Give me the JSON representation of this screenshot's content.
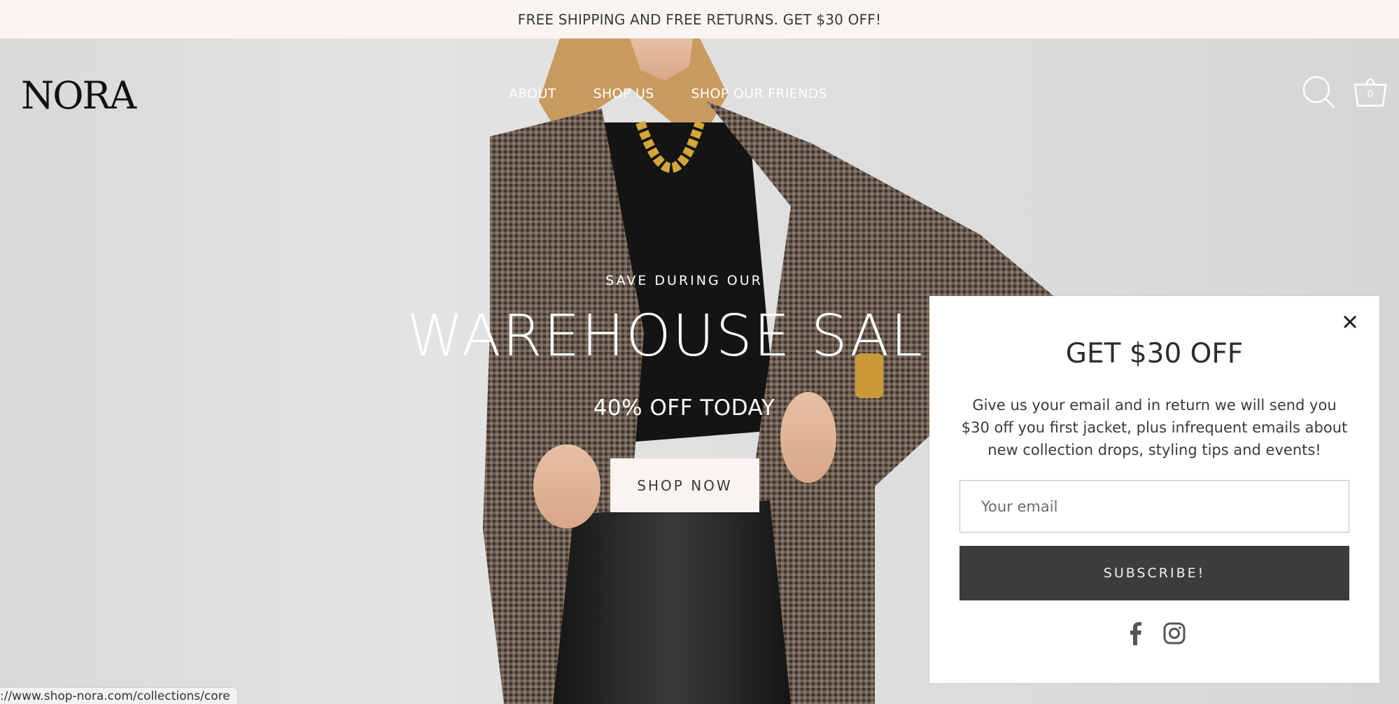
{
  "announcement": {
    "text": "FREE SHIPPING AND FREE RETURNS. GET $30 OFF!"
  },
  "header": {
    "logo": "NORA",
    "nav": [
      {
        "label": "ABOUT"
      },
      {
        "label": "SHOP US"
      },
      {
        "label": "SHOP OUR FRIENDS"
      }
    ],
    "search_icon": "search-icon",
    "cart_icon": "cart-icon",
    "cart_count": "0"
  },
  "hero": {
    "eyebrow": "SAVE DURING OUR",
    "headline": "WAREHOUSE SALE",
    "subhead": "40% OFF TODAY",
    "cta_label": "SHOP NOW"
  },
  "popup": {
    "title": "GET $30 OFF",
    "body": "Give us your email and in return we will send you $30 off you first jacket, plus infrequent emails about new collection drops, styling tips and events!",
    "email_placeholder": "Your email",
    "email_value": "",
    "subscribe_label": "SUBSCRIBE!",
    "social_icons": [
      "facebook-icon",
      "instagram-icon"
    ],
    "close_icon": "close-icon"
  },
  "status_bar": {
    "url": "://www.shop-nora.com/collections/core"
  },
  "colors": {
    "announcement_bg": "#f8f5f3",
    "button_dark": "#3d3c3d",
    "cta_bg": "#f8f5f3"
  }
}
